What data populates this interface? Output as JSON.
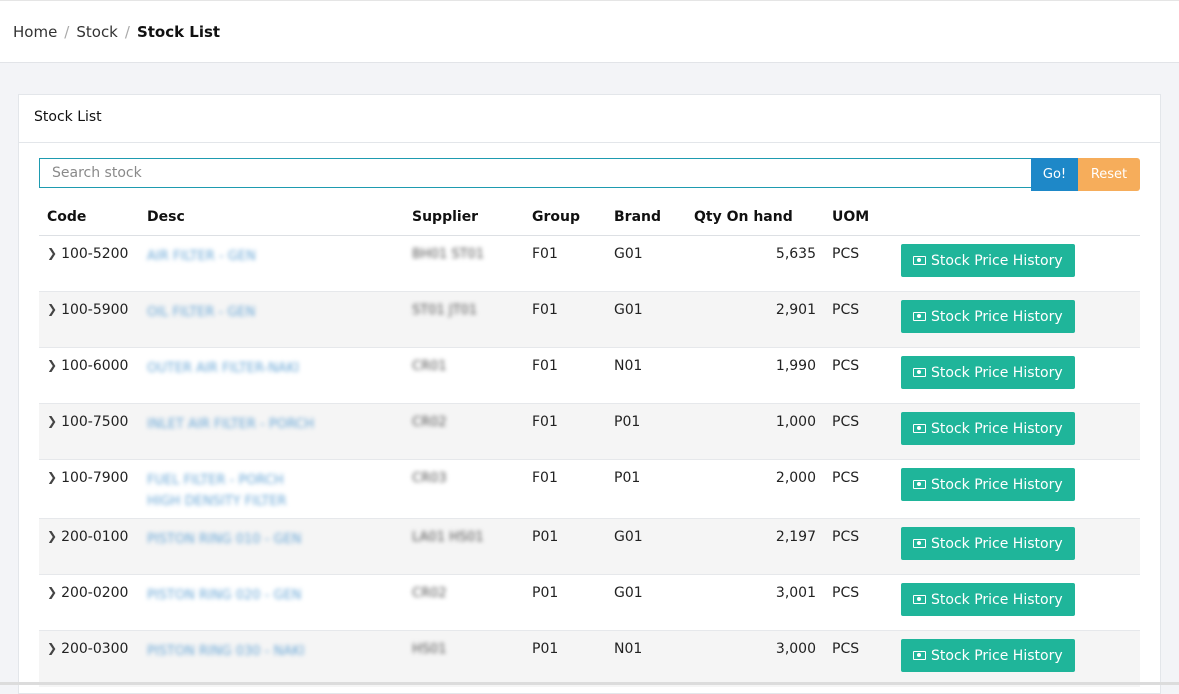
{
  "breadcrumb": {
    "home": "Home",
    "stock": "Stock",
    "current": "Stock List"
  },
  "card": {
    "title": "Stock List"
  },
  "search": {
    "placeholder": "Search stock",
    "go_label": "Go!",
    "reset_label": "Reset"
  },
  "colors": {
    "go": "#1e88c8",
    "reset": "#f6ad5b",
    "history": "#1fb59a",
    "link": "#6aa7d6"
  },
  "table": {
    "headers": [
      "Code",
      "Desc",
      "Supplier",
      "Group",
      "Brand",
      "Qty On hand",
      "UOM"
    ],
    "action_label": "Stock Price History",
    "action_icon": "money-icon",
    "rows": [
      {
        "code": "100-5200",
        "desc": "AIR FILTER - GEN",
        "desc2": "",
        "supplier": "BH01 ST01",
        "group": "F01",
        "brand": "G01",
        "qty": "5,635",
        "uom": "PCS"
      },
      {
        "code": "100-5900",
        "desc": "OIL FILTER - GEN",
        "desc2": "",
        "supplier": "ST01 JT01",
        "group": "F01",
        "brand": "G01",
        "qty": "2,901",
        "uom": "PCS"
      },
      {
        "code": "100-6000",
        "desc": "OUTER AIR FILTER-NAKI",
        "desc2": "",
        "supplier": "CR01",
        "group": "F01",
        "brand": "N01",
        "qty": "1,990",
        "uom": "PCS"
      },
      {
        "code": "100-7500",
        "desc": "INLET AIR FILTER - PORCH",
        "desc2": "",
        "supplier": "CR02",
        "group": "F01",
        "brand": "P01",
        "qty": "1,000",
        "uom": "PCS"
      },
      {
        "code": "100-7900",
        "desc": "FUEL FILTER - PORCH",
        "desc2": "HIGH DENSITY FILTER",
        "supplier": "CR03",
        "group": "F01",
        "brand": "P01",
        "qty": "2,000",
        "uom": "PCS"
      },
      {
        "code": "200-0100",
        "desc": "PISTON RING 010 - GEN",
        "desc2": "",
        "supplier": "LA01 HS01",
        "group": "P01",
        "brand": "G01",
        "qty": "2,197",
        "uom": "PCS"
      },
      {
        "code": "200-0200",
        "desc": "PISTON RING 020 - GEN",
        "desc2": "",
        "supplier": "CR02",
        "group": "P01",
        "brand": "G01",
        "qty": "3,001",
        "uom": "PCS"
      },
      {
        "code": "200-0300",
        "desc": "PISTON RING 030 - NAKI",
        "desc2": "",
        "supplier": "HS01",
        "group": "P01",
        "brand": "N01",
        "qty": "3,000",
        "uom": "PCS"
      }
    ]
  }
}
